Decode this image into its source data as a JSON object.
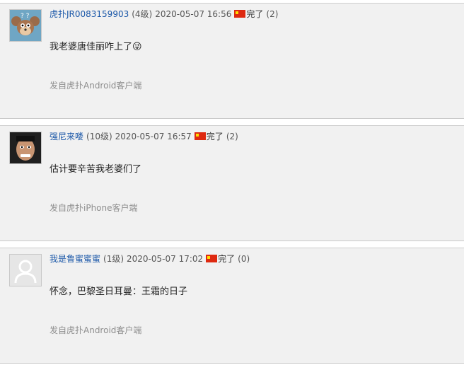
{
  "posts": [
    {
      "author": "虎扑JR0083159903",
      "level": "(4级)",
      "datetime": "2020-05-07 16:56",
      "reaction_label": "完了",
      "reaction_count": "(2)",
      "content": "我老婆唐佳丽咋上了😜",
      "source": "发自虎扑Android客户端"
    },
    {
      "author": "强尼来喽",
      "level": "(10级)",
      "datetime": "2020-05-07 16:57",
      "reaction_label": "完了",
      "reaction_count": "(2)",
      "content": "估计要辛苦我老婆们了",
      "source": "发自虎扑iPhone客户端"
    },
    {
      "author": "我是鲁蜜蜜蜜",
      "level": "(1级)",
      "datetime": "2020-05-07 17:02",
      "reaction_label": "完了",
      "reaction_count": "(0)",
      "content": "怀念，巴黎圣日耳曼：王霜的日子",
      "source": "发自虎扑Android客户端"
    }
  ],
  "colors": {
    "link": "#1a57a8",
    "flag_red": "#de2910",
    "flag_star": "#ffde00"
  }
}
